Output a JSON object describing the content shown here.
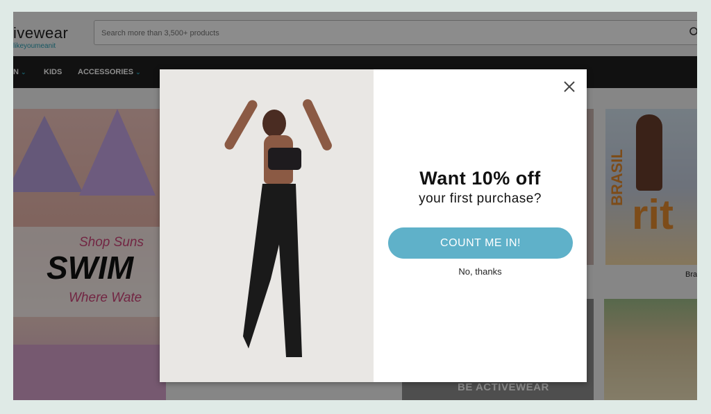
{
  "header": {
    "logo_text": "ivewear",
    "logo_tagline": "likeyoumeanit",
    "search_placeholder": "Search more than 3,500+ products"
  },
  "nav": {
    "items": [
      {
        "label": "N"
      },
      {
        "label": "KIDS"
      },
      {
        "label": "ACCESSORIES"
      }
    ]
  },
  "content": {
    "swim_banner": {
      "line1": "Shop Suns",
      "line2": "SWIM",
      "line3": "Where Wate"
    },
    "right_tile_label": "Bra",
    "brasil_text": "BRASIL",
    "rfit_text": "rit",
    "be_activewear": "BE ACTIVEWEAR"
  },
  "modal": {
    "headline": "Want 10% off",
    "subline": "your first purchase?",
    "cta_label": "COUNT ME IN!",
    "decline_label": "No, thanks",
    "close_icon": "close-icon"
  },
  "colors": {
    "accent": "#5fb1c9",
    "nav_bg": "#1f1f1f",
    "brand_teal": "#2a9fb3"
  }
}
